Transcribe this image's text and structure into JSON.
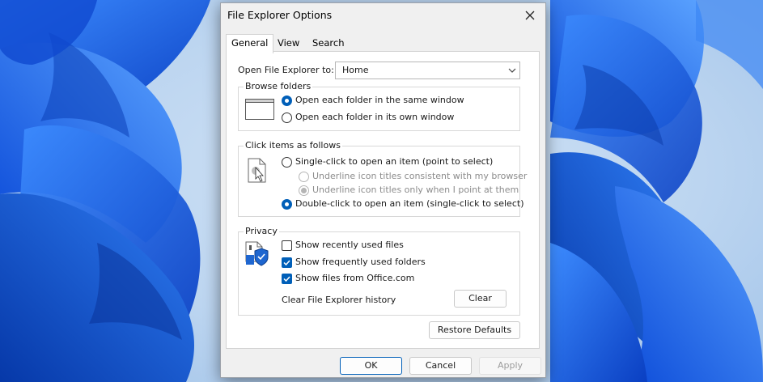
{
  "window": {
    "title": "File Explorer Options",
    "close_icon": "close-icon"
  },
  "tabs": [
    {
      "label": "General",
      "active": true
    },
    {
      "label": "View",
      "active": false
    },
    {
      "label": "Search",
      "active": false
    }
  ],
  "open_explorer": {
    "label": "Open File Explorer to:",
    "value": "Home"
  },
  "browse_folders": {
    "title": "Browse folders",
    "icon": "window-icon",
    "options": [
      {
        "label": "Open each folder in the same window",
        "checked": true
      },
      {
        "label": "Open each folder in its own window",
        "checked": false
      }
    ]
  },
  "click_items": {
    "title": "Click items as follows",
    "icon": "cursor-document-icon",
    "single_click": {
      "label": "Single-click to open an item (point to select)",
      "checked": false
    },
    "underline_consistent": {
      "label": "Underline icon titles consistent with my browser",
      "checked": false,
      "disabled": true
    },
    "underline_point": {
      "label": "Underline icon titles only when I point at them",
      "checked": true,
      "disabled": true
    },
    "double_click": {
      "label": "Double-click to open an item (single-click to select)",
      "checked": true
    }
  },
  "privacy": {
    "title": "Privacy",
    "icon": "privacy-shield-icon",
    "show_recent_files": {
      "label": "Show recently used files",
      "checked": false
    },
    "show_frequent_folders": {
      "label": "Show frequently used folders",
      "checked": true
    },
    "show_office_files": {
      "label": "Show files from Office.com",
      "checked": true
    },
    "clear_history_label": "Clear File Explorer history",
    "clear_button": "Clear"
  },
  "restore_defaults": "Restore Defaults",
  "footer": {
    "ok": "OK",
    "cancel": "Cancel",
    "apply": "Apply"
  },
  "colors": {
    "accent": "#005fb8",
    "wallpaper": "#1565e0",
    "dialog_bg": "#f0f0f0"
  }
}
